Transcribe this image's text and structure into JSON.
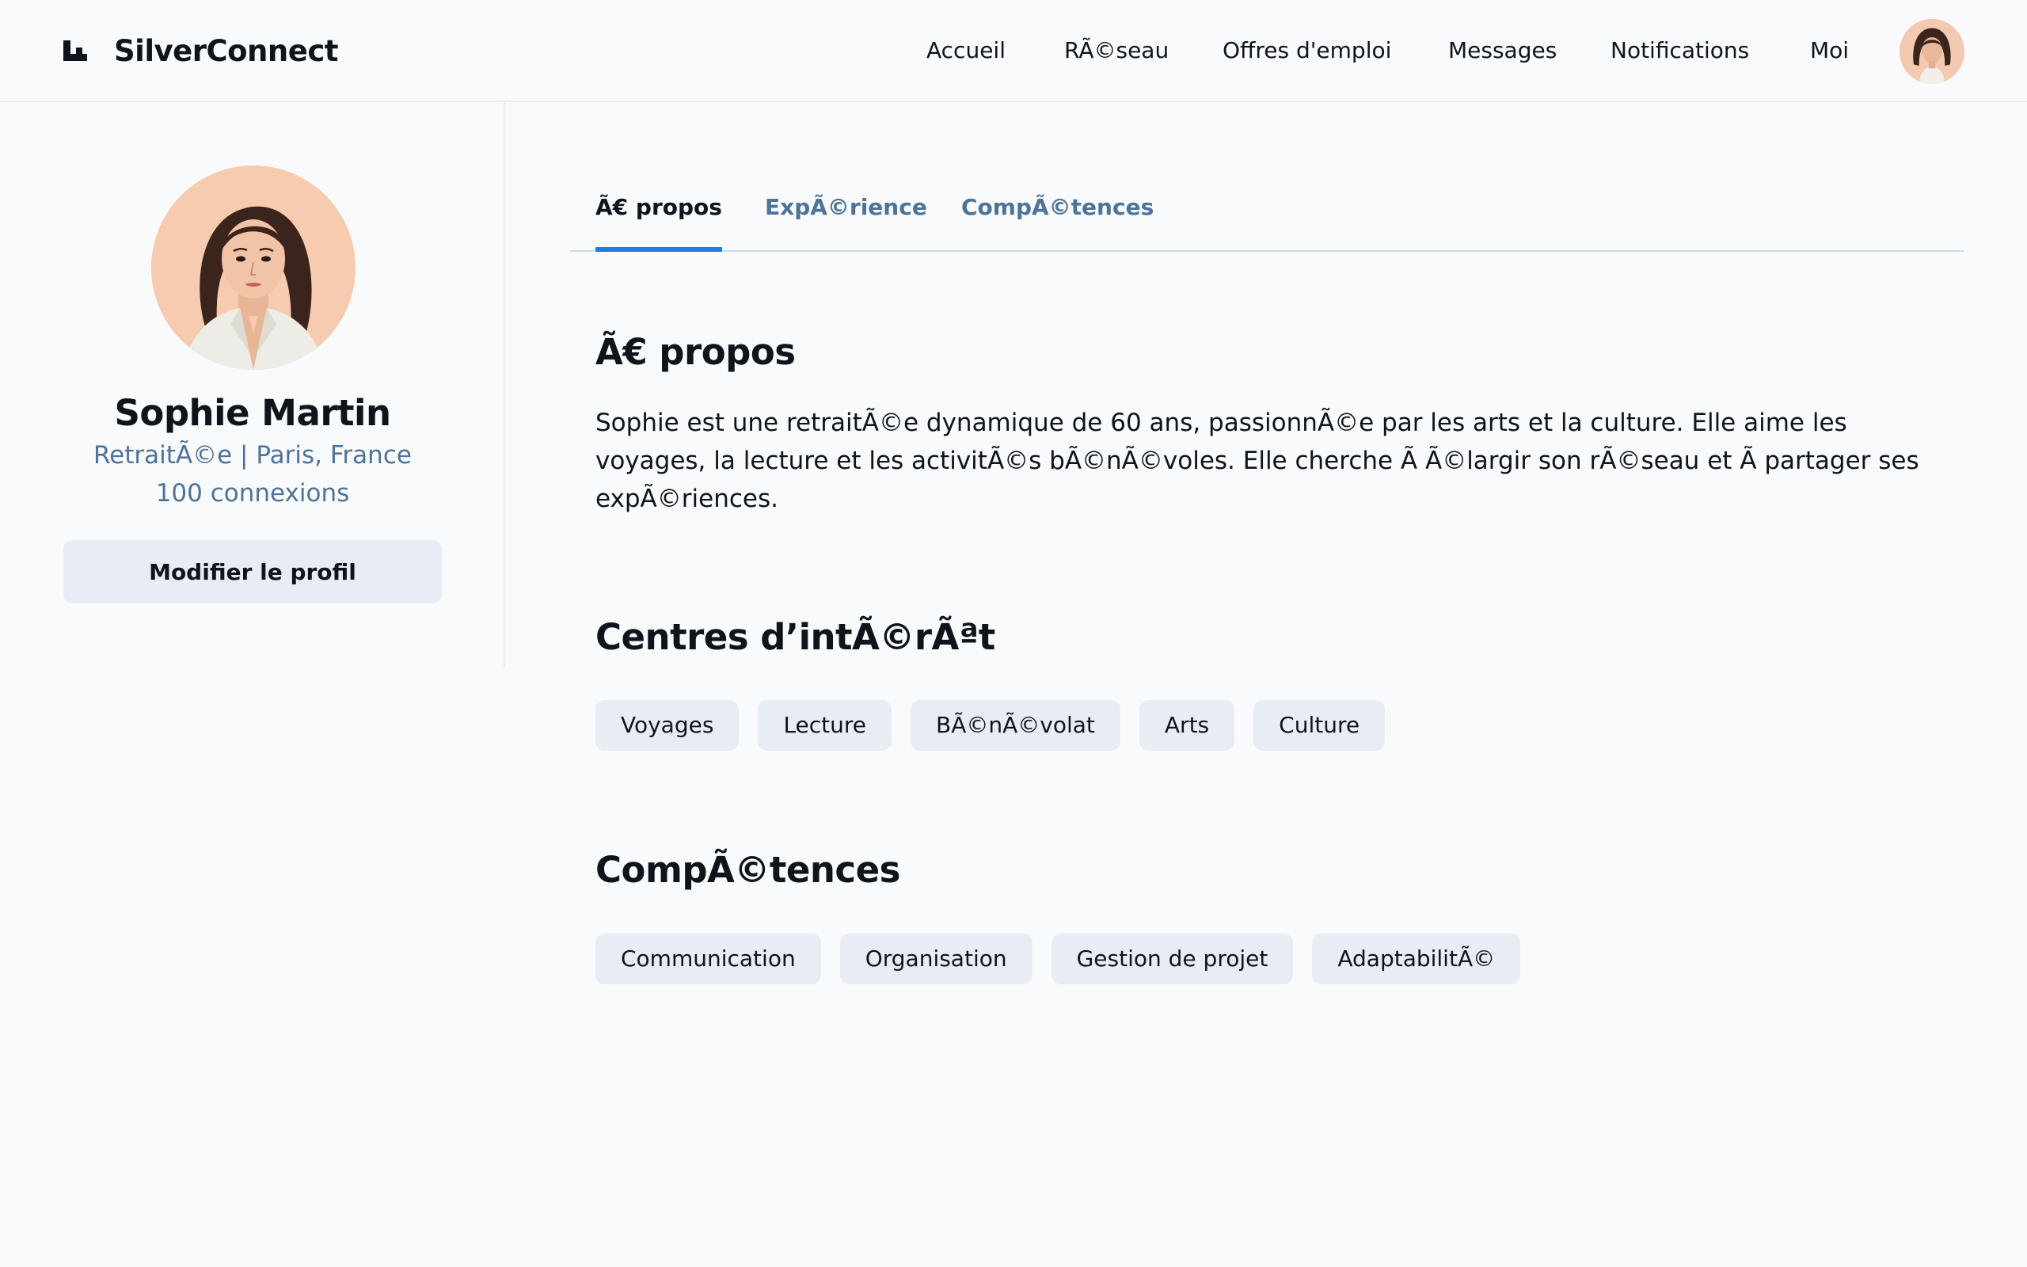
{
  "app": {
    "name": "SilverConnect",
    "logo_icon": "logo-icon"
  },
  "nav": {
    "items": [
      {
        "label": "Accueil",
        "name": "nav-accueil"
      },
      {
        "label": "RÃ©seau",
        "name": "nav-reseau"
      },
      {
        "label": "Offres d'emploi",
        "name": "nav-offres"
      },
      {
        "label": "Messages",
        "name": "nav-messages"
      },
      {
        "label": "Notifications",
        "name": "nav-notifications"
      },
      {
        "label": "Moi",
        "name": "nav-moi"
      }
    ]
  },
  "profile": {
    "name": "Sophie Martin",
    "headline": "RetraitÃ©e | Paris, France",
    "connections": "100 connexions",
    "edit_label": "Modifier le profil"
  },
  "tabs": [
    {
      "label": "Ã€ propos",
      "active": true
    },
    {
      "label": "ExpÃ©rience",
      "active": false
    },
    {
      "label": "CompÃ©tences",
      "active": false
    }
  ],
  "about": {
    "title": "Ã€ propos",
    "text": "Sophie est une retraitÃ©e dynamique de 60 ans, passionnÃ©e par les arts et la culture. Elle aime les voyages, la lecture et les activitÃ©s bÃ©nÃ©voles. Elle cherche Ã  Ã©largir son rÃ©seau et Ã  partager ses expÃ©riences."
  },
  "interests": {
    "title": "Centres d’intÃ©rÃªt",
    "items": [
      "Voyages",
      "Lecture",
      "BÃ©nÃ©volat",
      "Arts",
      "Culture"
    ]
  },
  "skills": {
    "title": "CompÃ©tences",
    "items": [
      "Communication",
      "Organisation",
      "Gestion de projet",
      "AdaptabilitÃ©"
    ]
  },
  "colors": {
    "background": "#f8fafc",
    "text_primary": "#0e141b",
    "text_secondary": "#4e7397",
    "chip_bg": "#e7edf3",
    "accent": "#1980e6"
  }
}
